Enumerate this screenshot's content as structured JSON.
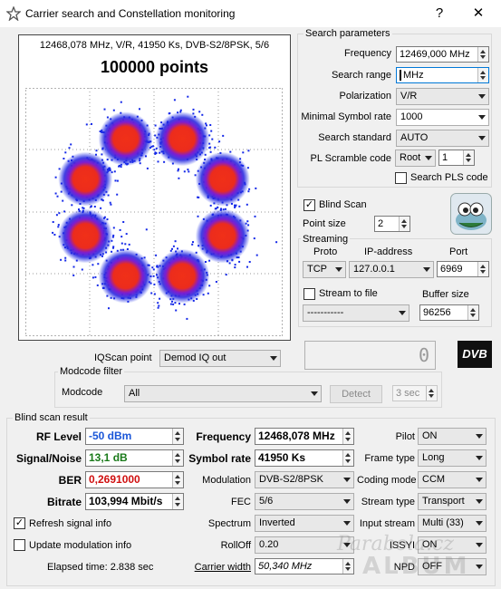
{
  "window": {
    "title": "Carrier search and Constellation monitoring",
    "help": "?",
    "close": "✕"
  },
  "plot": {
    "info": "12468,078 MHz, V/R, 41950 Ks, DVB-S2/8PSK, 5/6",
    "points": "100000 points",
    "constellation": "8PSK",
    "colors": {
      "core": "#f03018",
      "mid": "#7d1dd0",
      "outer": "#1428e8"
    }
  },
  "search_params": {
    "group": "Search parameters",
    "frequency_label": "Frequency",
    "frequency": "12469,000 MHz",
    "range_label": "Search range",
    "range": "MHz",
    "polarization_label": "Polarization",
    "polarization": "V/R",
    "min_sr_label": "Minimal Symbol rate",
    "min_sr": "1000",
    "standard_label": "Search standard",
    "standard": "AUTO",
    "pls_label": "PL Scramble code",
    "pls_mode": "Root",
    "pls_value": "1",
    "search_pls": "Search PLS code"
  },
  "blind": {
    "label": "Blind Scan",
    "checked": "✓",
    "point_size_label": "Point size",
    "point_size": "2"
  },
  "streaming": {
    "group": "Streaming",
    "proto_label": "Proto",
    "ip_label": "IP-address",
    "port_label": "Port",
    "proto": "TCP",
    "ip": "127.0.0.1",
    "port": "6969",
    "to_file": "Stream to file",
    "file": "-----------",
    "buffer_label": "Buffer size",
    "buffer": "96256"
  },
  "lcd": {
    "value": "0"
  },
  "dvb_logo": "DVB",
  "iqscan": {
    "label": "IQScan point",
    "value": "Demod IQ out"
  },
  "modcode": {
    "group": "Modcode filter",
    "label": "Modcode",
    "value": "All",
    "detect": "Detect",
    "interval": "3 sec"
  },
  "result": {
    "group": "Blind scan result",
    "rf_label": "RF Level",
    "rf": "-50 dBm",
    "rf_color": "#1a56d8",
    "snr_label": "Signal/Noise",
    "snr": "13,1 dB",
    "snr_color": "#1a7a1a",
    "ber_label": "BER",
    "ber": "0,2691000",
    "ber_color": "#d01010",
    "bitrate_label": "Bitrate",
    "bitrate": "103,994 Mbit/s",
    "freq_label": "Frequency",
    "freq": "12468,078 MHz",
    "sr_label": "Symbol rate",
    "sr": "41950 Ks",
    "modulation_label": "Modulation",
    "modulation": "DVB-S2/8PSK",
    "fec_label": "FEC",
    "fec": "5/6",
    "spectrum_label": "Spectrum",
    "spectrum": "Inverted",
    "rolloff_label": "RollOff",
    "rolloff": "0.20",
    "cw_label": "Carrier width",
    "cw": "50,340 MHz",
    "pilot_label": "Pilot",
    "pilot": "ON",
    "frame_label": "Frame type",
    "frame": "Long",
    "coding_label": "Coding mode",
    "coding": "CCM",
    "stream_label": "Stream type",
    "stream": "Transport",
    "input_label": "Input stream",
    "input": "Multi (33)",
    "issyi_label": "ISSYI",
    "issyi": "ON",
    "npd_label": "NPD",
    "npd": "OFF",
    "refresh": "Refresh signal info",
    "refresh_checked": "✓",
    "update_mod": "Update modulation info",
    "elapsed": "Elapsed time: 2.838 sec"
  },
  "watermark": {
    "line1": "Parabola.cz",
    "line2": "ALBUM"
  }
}
